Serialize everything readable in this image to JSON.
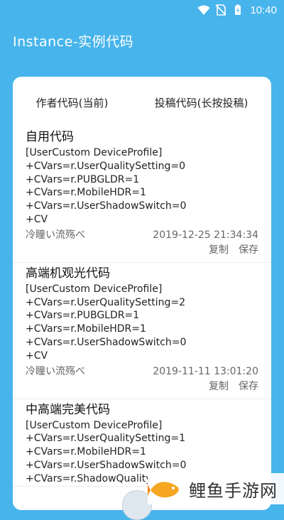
{
  "status": {
    "time": "10:40"
  },
  "appbar": {
    "title": "Instance-实例代码"
  },
  "tabs": [
    {
      "label": "作者代码(当前)"
    },
    {
      "label": "投稿代码(长按投稿)"
    }
  ],
  "items": [
    {
      "name": "自用代码",
      "lines": [
        "[UserCustom DeviceProfile]",
        "+CVars=r.UserQualitySetting=0",
        "+CVars=r.PUBGLDR=1",
        "+CVars=r.MobileHDR=1",
        "+CVars=r.UserShadowSwitch=0",
        "+CV"
      ],
      "author": "冷瞳い流殇べ",
      "date": "2019-12-25 21:34:34"
    },
    {
      "name": "高端机观光代码",
      "lines": [
        "[UserCustom DeviceProfile]",
        "+CVars=r.UserQualitySetting=2",
        "+CVars=r.PUBGLDR=1",
        "+CVars=r.MobileHDR=1",
        "+CVars=r.UserShadowSwitch=0",
        "+CV"
      ],
      "author": "冷瞳い流殇べ",
      "date": "2019-11-11 13:01:20"
    },
    {
      "name": "中高端完美代码",
      "lines": [
        "[UserCustom DeviceProfile]",
        "+CVars=r.UserQualitySetting=1",
        "+CVars=r.MobileHDR=1",
        "+CVars=r.UserShadowSwitch=0",
        "+CVars=r.ShadowQuality"
      ]
    }
  ],
  "actions": {
    "copy": "复制",
    "save": "保存"
  },
  "watermark": {
    "text": "鲤鱼手游网"
  },
  "colors": {
    "header_bg": "#47b4ec",
    "card_bg": "#ffffff",
    "accent_fish": "#f5a623"
  }
}
